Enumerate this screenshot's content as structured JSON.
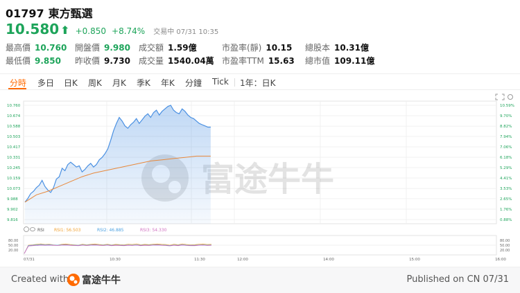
{
  "stock": {
    "ticker": "01797",
    "name": "東方甄選",
    "price": "10.580",
    "change": "+0.850",
    "change_pct": "+8.74%",
    "status": "交易中 07/31 10:35"
  },
  "stats": [
    {
      "label": "最高價",
      "value": "10.760",
      "color": "green"
    },
    {
      "label": "開盤價",
      "value": "9.980",
      "color": "green"
    },
    {
      "label": "成交額",
      "value": "1.59億",
      "color": "black"
    },
    {
      "label": "市盈率(靜)",
      "value": "10.15",
      "color": "black"
    },
    {
      "label": "總股本",
      "value": "10.31億",
      "color": "black"
    },
    {
      "label": "最低價",
      "value": "9.850",
      "color": "green"
    },
    {
      "label": "昨收價",
      "value": "9.730",
      "color": "black"
    },
    {
      "label": "成交量",
      "value": "1540.04萬",
      "color": "black"
    },
    {
      "label": "市盈率TTM",
      "value": "15.63",
      "color": "black"
    },
    {
      "label": "總市值",
      "value": "109.11億",
      "color": "black"
    }
  ],
  "tabs": [
    "分時",
    "多日",
    "日K",
    "周K",
    "月K",
    "季K",
    "年K",
    "分鐘",
    "Tick",
    "1年：日K"
  ],
  "watermark": "富途牛牛",
  "chart_data": {
    "type": "line",
    "y_left_ticks": [
      "10.760",
      "10.674",
      "10.588",
      "10.503",
      "10.417",
      "10.331",
      "10.245",
      "10.159",
      "10.073",
      "9.988",
      "9.902",
      "9.816"
    ],
    "y_right_ticks": [
      "10.59%",
      "9.70%",
      "8.82%",
      "7.94%",
      "7.06%",
      "6.18%",
      "5.29%",
      "4.41%",
      "3.53%",
      "2.65%",
      "1.76%",
      "0.88%"
    ],
    "ylim": [
      9.816,
      10.76
    ],
    "x_ticks": [
      "07/31",
      "10:30",
      "11:30",
      "12:00",
      "14:00",
      "15:00",
      "16:00"
    ],
    "series": [
      {
        "name": "price",
        "x": [
          0,
          1,
          2,
          3,
          4,
          5,
          6,
          7,
          8,
          9,
          10,
          11,
          12,
          13,
          14,
          15,
          16,
          17,
          18,
          19,
          20,
          21,
          22,
          23,
          24,
          25,
          26,
          27,
          28,
          29,
          30,
          31,
          32,
          33,
          34,
          35,
          36,
          37,
          38,
          39,
          40,
          41,
          42,
          43,
          44,
          45,
          46,
          47,
          48,
          49,
          50,
          51,
          52,
          53,
          54,
          55,
          56,
          57,
          58,
          59,
          60,
          61,
          62,
          63,
          64,
          65
        ],
        "values": [
          9.96,
          9.99,
          10.03,
          10.05,
          10.08,
          10.1,
          10.14,
          10.09,
          10.06,
          10.04,
          10.08,
          10.15,
          10.17,
          10.24,
          10.22,
          10.27,
          10.29,
          10.27,
          10.25,
          10.26,
          10.21,
          10.23,
          10.26,
          10.28,
          10.25,
          10.27,
          10.31,
          10.33,
          10.36,
          10.4,
          10.47,
          10.55,
          10.61,
          10.66,
          10.63,
          10.59,
          10.57,
          10.6,
          10.62,
          10.65,
          10.61,
          10.64,
          10.67,
          10.69,
          10.66,
          10.7,
          10.72,
          10.68,
          10.71,
          10.73,
          10.75,
          10.76,
          10.72,
          10.7,
          10.69,
          10.73,
          10.71,
          10.68,
          10.66,
          10.65,
          10.63,
          10.61,
          10.6,
          10.59,
          10.58,
          10.58
        ]
      },
      {
        "name": "average",
        "x": [
          0,
          4,
          8,
          12,
          16,
          20,
          24,
          28,
          32,
          36,
          40,
          44,
          48,
          52,
          56,
          60,
          65
        ],
        "values": [
          9.96,
          10.02,
          10.05,
          10.09,
          10.13,
          10.17,
          10.2,
          10.22,
          10.24,
          10.26,
          10.28,
          10.3,
          10.31,
          10.32,
          10.33,
          10.34,
          10.34
        ]
      }
    ],
    "rsi": {
      "rsi1_label": "RSI1: 56.503",
      "rsi2_label": "RSI2: 46.885",
      "rsi3_label": "RSI3: 54.330",
      "indicator_name": "RSI",
      "y_ticks_left": [
        "80.00",
        "50.00",
        "20.00"
      ],
      "y_ticks_right": [
        "80.00",
        "50.00",
        "20.00"
      ],
      "ylim": [
        0,
        100
      ],
      "rsi1": [
        0,
        50,
        52,
        55,
        58,
        54,
        56,
        52,
        50,
        55,
        57,
        54,
        52,
        50,
        56,
        52,
        55,
        57,
        54,
        52,
        56,
        51,
        55,
        53,
        52,
        56,
        54,
        58,
        52,
        55,
        53,
        56,
        57,
        55,
        54,
        50,
        56,
        52,
        58,
        54,
        52,
        53,
        56,
        57,
        54,
        55
      ],
      "rsi2": [
        0,
        48,
        50,
        52,
        54,
        52,
        53,
        51,
        50,
        52,
        53,
        51,
        50,
        49,
        52,
        50,
        52,
        53,
        51,
        50,
        52,
        49,
        51,
        50,
        49,
        51,
        50,
        52,
        49,
        51,
        50,
        52,
        53,
        51,
        50,
        48,
        51,
        49,
        53,
        50,
        49,
        49,
        51,
        52,
        50,
        51
      ],
      "rsi3": [
        0,
        45,
        47,
        48,
        50,
        49,
        50,
        49,
        48,
        50,
        51,
        49,
        48,
        47,
        50,
        48,
        50,
        51,
        49,
        48,
        50,
        47,
        49,
        48,
        47,
        49,
        48,
        50,
        47,
        49,
        48,
        50,
        51,
        49,
        48,
        46,
        49,
        47,
        51,
        48,
        47,
        47,
        49,
        50,
        48,
        49
      ]
    }
  },
  "footer": {
    "created_with": "Created with",
    "brand": "富途牛牛",
    "published": "Published on CN 07/31"
  },
  "colors": {
    "up": "#1da45a",
    "accent": "#ff6a00",
    "price_line": "#4a90e2",
    "avg_line": "#e8883a",
    "rsi1": "#f0a030",
    "rsi2": "#4aa0e0",
    "rsi3": "#d070c0"
  },
  "icons": [
    "arrow-up-icon",
    "fullscreen-icon",
    "settings-icon",
    "close-icon",
    "eye-icon",
    "futu-logo-icon"
  ]
}
